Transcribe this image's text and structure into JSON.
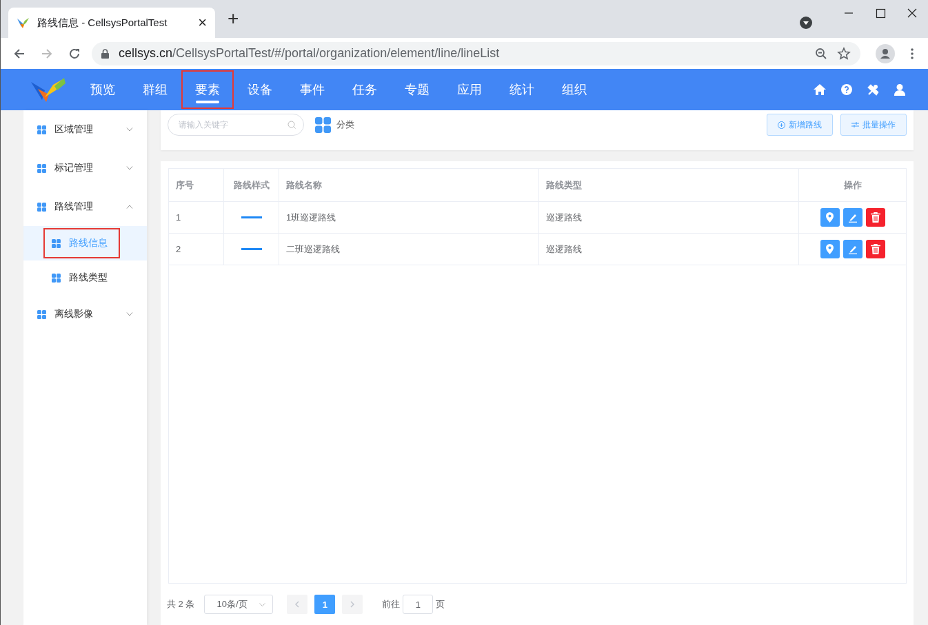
{
  "browser": {
    "tab_title": "路线信息 - CellsysPortalTest",
    "tab_close": "×",
    "new_tab": "+",
    "url_host": "cellsys.cn",
    "url_path": "/CellsysPortalTest/#/portal/organization/element/line/lineList"
  },
  "nav": {
    "items": [
      {
        "label": "预览",
        "selected": false,
        "highlighted": false
      },
      {
        "label": "群组",
        "selected": false,
        "highlighted": false
      },
      {
        "label": "要素",
        "selected": true,
        "highlighted": true
      },
      {
        "label": "设备",
        "selected": false,
        "highlighted": false
      },
      {
        "label": "事件",
        "selected": false,
        "highlighted": false
      },
      {
        "label": "任务",
        "selected": false,
        "highlighted": false
      },
      {
        "label": "专题",
        "selected": false,
        "highlighted": false
      },
      {
        "label": "应用",
        "selected": false,
        "highlighted": false
      },
      {
        "label": "统计",
        "selected": false,
        "highlighted": false
      },
      {
        "label": "组织",
        "selected": false,
        "highlighted": false
      }
    ]
  },
  "sidebar": {
    "items": [
      {
        "label": "区域管理",
        "expanded": false
      },
      {
        "label": "标记管理",
        "expanded": false
      },
      {
        "label": "路线管理",
        "expanded": true,
        "children": [
          {
            "label": "路线信息",
            "selected": true,
            "highlighted": true
          },
          {
            "label": "路线类型",
            "selected": false,
            "highlighted": false
          }
        ]
      },
      {
        "label": "离线影像",
        "expanded": false
      }
    ]
  },
  "toolbar": {
    "search": {
      "placeholder": "请输入关键字"
    },
    "category": "分类",
    "buttons": [
      "新增路线",
      "批量操作"
    ]
  },
  "table": {
    "columns": [
      "序号",
      "路线样式",
      "路线名称",
      "路线类型",
      "操作"
    ],
    "rows": [
      {
        "index": "1",
        "name": "1班巡逻路线",
        "type": "巡逻路线"
      },
      {
        "index": "2",
        "name": "二班巡逻路线",
        "type": "巡逻路线"
      }
    ]
  },
  "pagination": {
    "total": "共 2 条",
    "page_size": "10条/页",
    "pages": [
      {
        "label": "1",
        "selected": true
      }
    ],
    "goto_label": "前往",
    "goto_value": "1",
    "page_suffix": "页"
  }
}
